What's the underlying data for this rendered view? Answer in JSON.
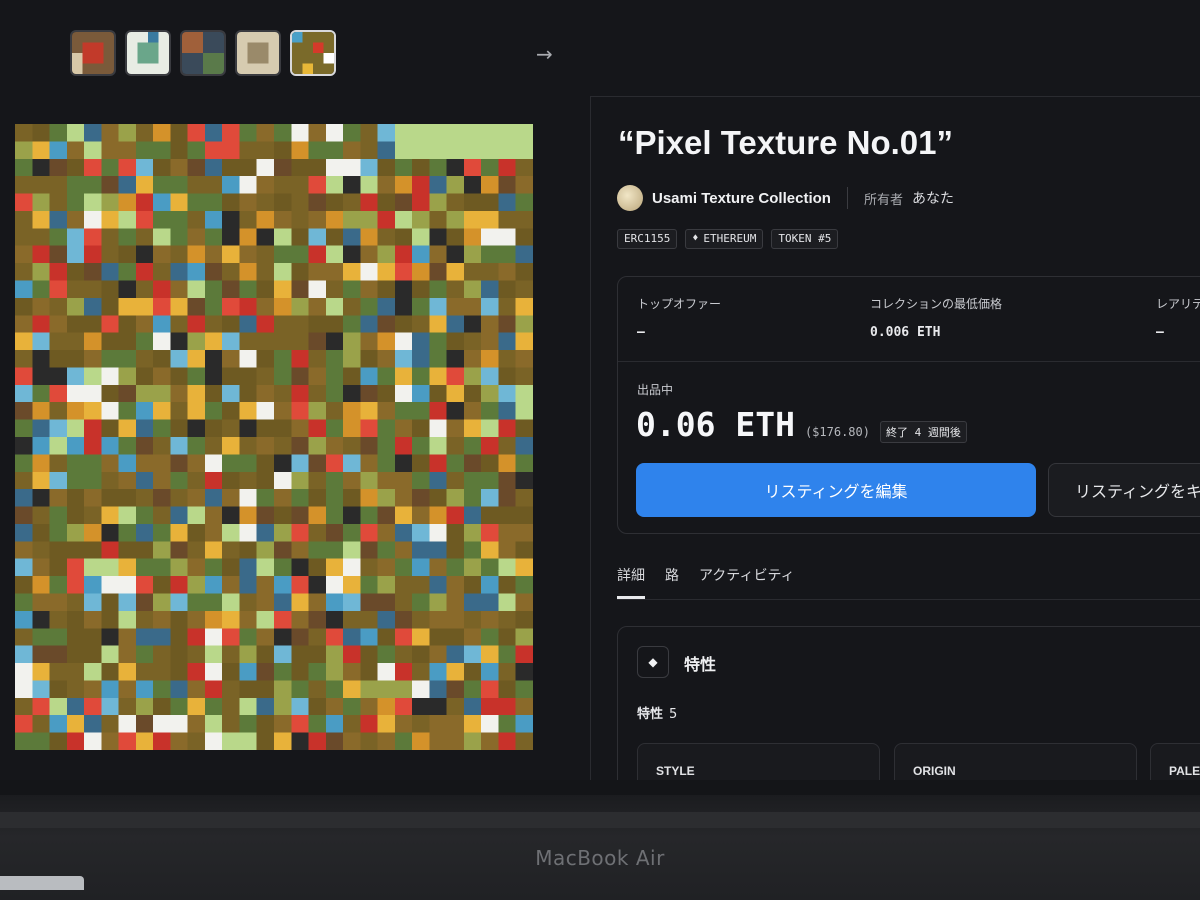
{
  "gallery": {
    "thumbnails": [
      "thumb-1",
      "thumb-2",
      "thumb-3",
      "thumb-4",
      "thumb-5"
    ],
    "active_index": 4,
    "next_icon": "arrow-right-icon"
  },
  "item": {
    "title": "“Pixel Texture No.01”",
    "collection_name": "Usami Texture Collection",
    "owner_label": "所有者",
    "owner_value": "あなた",
    "badges": {
      "standard": "ERC1155",
      "chain": "ETHEREUM",
      "token": "TOKEN #5"
    }
  },
  "pricing": {
    "top_offer_label": "トップオファー",
    "top_offer_value": "–",
    "floor_label": "コレクションの最低価格",
    "floor_value": "0.006 ETH",
    "rarity_label": "レアリテ",
    "rarity_value": "–",
    "listing_label": "出品中",
    "price": "0.06 ETH",
    "price_usd": "($176.80)",
    "expires": "終了 4 週間後",
    "edit_button": "リスティングを編集",
    "cancel_button": "リスティングをキ"
  },
  "tabs": [
    "詳細",
    "路",
    "アクティビティ"
  ],
  "traits": {
    "title": "特性",
    "count_label": "特性",
    "count_value": "5",
    "cards": [
      "STYLE",
      "ORIGIN",
      "PALET"
    ]
  },
  "device": {
    "brand": "MacBook Air"
  },
  "colors": {
    "accent": "#2f83ec",
    "background": "#15161a"
  }
}
